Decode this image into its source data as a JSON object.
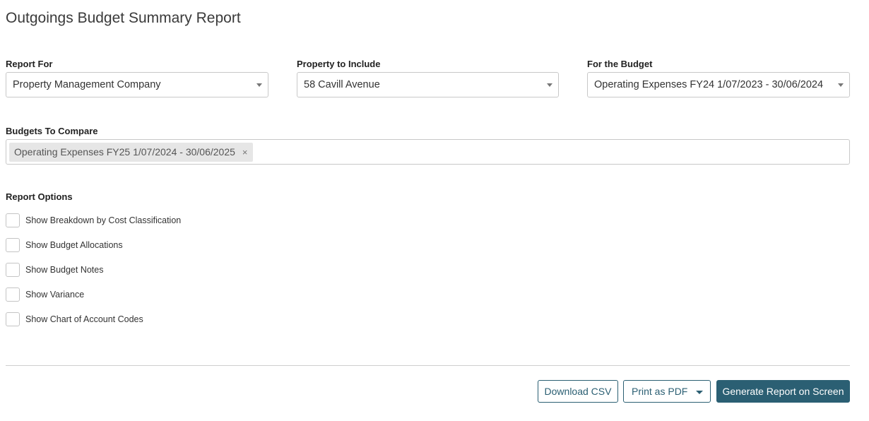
{
  "page": {
    "title": "Outgoings Budget Summary Report"
  },
  "filters": {
    "report_for": {
      "label": "Report For",
      "value": "Property Management Company"
    },
    "property": {
      "label": "Property to Include",
      "value": "58 Cavill Avenue"
    },
    "budget": {
      "label": "For the Budget",
      "value": "Operating Expenses FY24 1/07/2023 - 30/06/2024"
    }
  },
  "compare": {
    "label": "Budgets To Compare",
    "chips": [
      {
        "label": "Operating Expenses FY25 1/07/2024 - 30/06/2025",
        "remove": "×"
      }
    ]
  },
  "options": {
    "label": "Report Options",
    "items": [
      {
        "label": "Show Breakdown by Cost Classification",
        "checked": false
      },
      {
        "label": "Show Budget Allocations",
        "checked": false
      },
      {
        "label": "Show Budget Notes",
        "checked": false
      },
      {
        "label": "Show Variance",
        "checked": false
      },
      {
        "label": "Show Chart of Account Codes",
        "checked": false
      }
    ]
  },
  "actions": {
    "download_csv": "Download CSV",
    "print_pdf": "Print as PDF",
    "generate": "Generate Report on Screen"
  },
  "colors": {
    "accent": "#2b5f73"
  }
}
